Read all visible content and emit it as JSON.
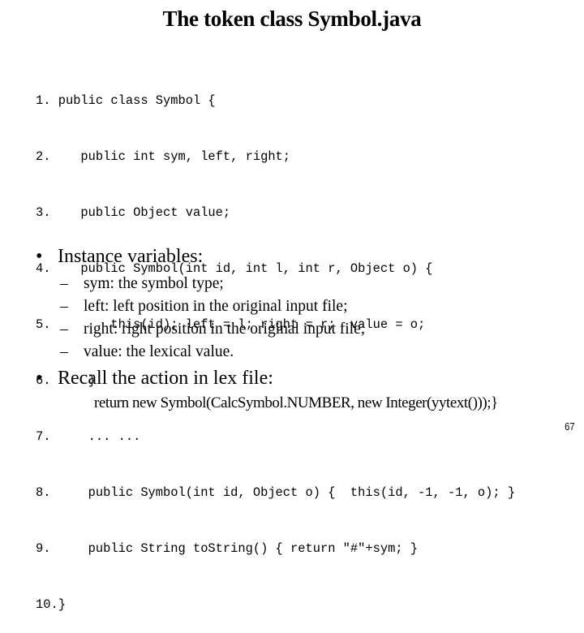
{
  "slide": {
    "title": "The token class Symbol.java",
    "page_number": "67"
  },
  "code": {
    "lines": [
      {
        "num": "1. ",
        "text": "public class Symbol {"
      },
      {
        "num": "2. ",
        "text": "   public int sym, left, right;"
      },
      {
        "num": "3. ",
        "text": "   public Object value;"
      },
      {
        "num": "4. ",
        "text": "   public Symbol(int id, int l, int r, Object o) {"
      },
      {
        "num": "5. ",
        "text": "       this(id); left = l; right = r;  value = o;"
      },
      {
        "num": "6. ",
        "text": "    }"
      },
      {
        "num": "7. ",
        "text": "    ... ..."
      },
      {
        "num": "8. ",
        "text": "    public Symbol(int id, Object o) {  this(id, -1, -1, o); }"
      },
      {
        "num": "9. ",
        "text": "    public String toString() { return \"#\"+sym; }"
      },
      {
        "num": "10.",
        "text": "}"
      }
    ]
  },
  "bullets": {
    "instance_variables": {
      "bullet": "•",
      "heading": "Instance variables:",
      "items": [
        {
          "dash": "–",
          "text": "sym: the symbol type;"
        },
        {
          "dash": "–",
          "text": "left: left position in the original input file;"
        },
        {
          "dash": "–",
          "text": "right: right position in the original input file;"
        },
        {
          "dash": "–",
          "text": "value: the lexical value."
        }
      ]
    },
    "recall": {
      "bullet": "•",
      "heading": "Recall the action in lex file:",
      "code": "return new Symbol(CalcSymbol.NUMBER, new Integer(yytext()));}"
    }
  }
}
